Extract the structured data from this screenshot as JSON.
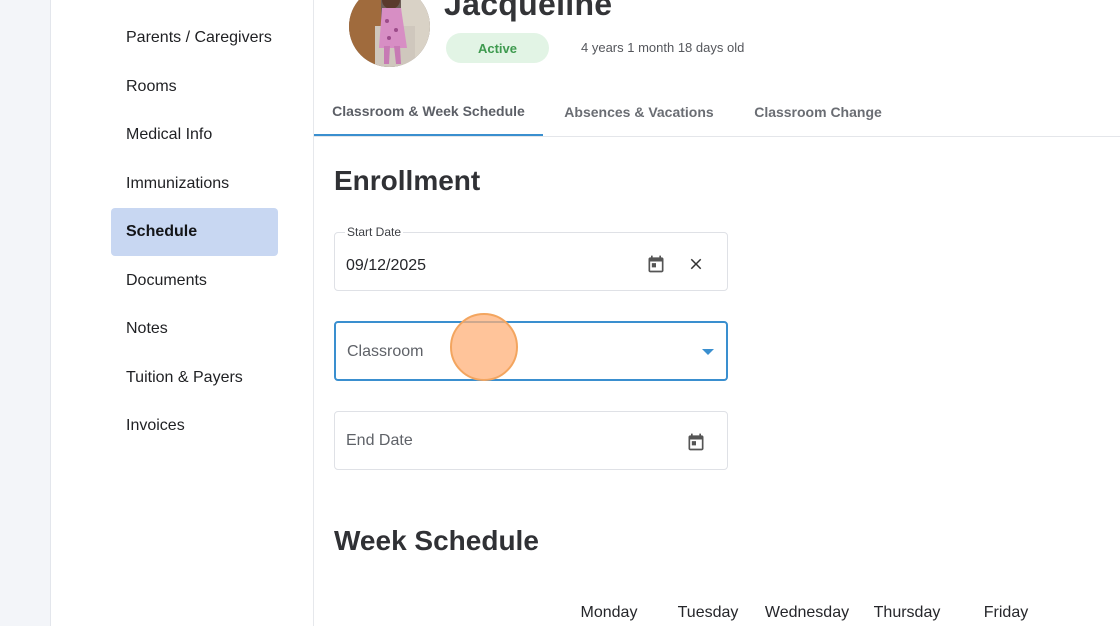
{
  "sidebar": {
    "items": [
      {
        "label": "Parents / Caregivers",
        "active": false
      },
      {
        "label": "Rooms",
        "active": false
      },
      {
        "label": "Medical Info",
        "active": false
      },
      {
        "label": "Immunizations",
        "active": false
      },
      {
        "label": "Schedule",
        "active": true
      },
      {
        "label": "Documents",
        "active": false
      },
      {
        "label": "Notes",
        "active": false
      },
      {
        "label": "Tuition & Payers",
        "active": false
      },
      {
        "label": "Invoices",
        "active": false
      }
    ]
  },
  "header": {
    "child_name": "Jacqueline",
    "status": "Active",
    "age": "4 years 1 month 18 days old",
    "avatar_icon": "child-photo"
  },
  "tabs": [
    {
      "label": "Classroom & Week Schedule",
      "active": true
    },
    {
      "label": "Absences & Vacations",
      "active": false
    },
    {
      "label": "Classroom Change",
      "active": false
    }
  ],
  "enrollment": {
    "title": "Enrollment",
    "start_date": {
      "label": "Start Date",
      "value": "09/12/2025",
      "icons": [
        "calendar-icon",
        "close-icon"
      ]
    },
    "classroom": {
      "placeholder": "Classroom",
      "icon": "caret-down-icon"
    },
    "end_date": {
      "placeholder": "End Date",
      "icon": "calendar-icon"
    }
  },
  "week_schedule": {
    "title": "Week Schedule",
    "days": [
      "Monday",
      "Tuesday",
      "Wednesday",
      "Thursday",
      "Friday"
    ]
  },
  "colors": {
    "accent": "#3a8fcf",
    "active_nav_bg": "#c8d7f2",
    "status_bg": "#e2f4e5",
    "status_text": "#3e9a4f",
    "click_marker": "#f3a55f"
  }
}
